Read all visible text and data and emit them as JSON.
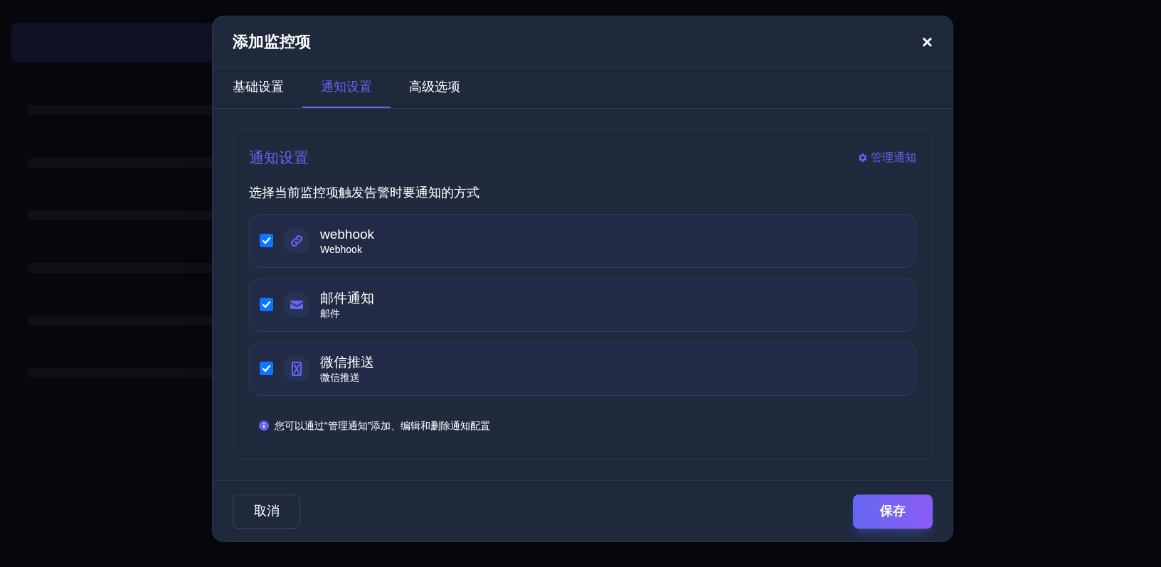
{
  "dialog": {
    "title": "添加监控项",
    "close": "×"
  },
  "tabs": [
    {
      "label": "基础设置",
      "selected": false
    },
    {
      "label": "通知设置",
      "selected": true
    },
    {
      "label": "高级选项",
      "selected": false
    }
  ],
  "section": {
    "title": "通知设置",
    "manage_link": "管理通知",
    "description": "选择当前监控项触发告警时要通知的方式",
    "channels": [
      {
        "kind": "link",
        "name": "webhook",
        "type": "Webhook",
        "checked": true
      },
      {
        "kind": "mail",
        "name": "邮件通知",
        "type": "邮件",
        "checked": true
      },
      {
        "kind": "wechat",
        "name": "微信推送",
        "type": "微信推送",
        "checked": true
      }
    ],
    "hint": "您可以通过“管理通知”添加、编辑和删除通知配置"
  },
  "buttons": {
    "cancel": "取消",
    "save": "保存"
  }
}
